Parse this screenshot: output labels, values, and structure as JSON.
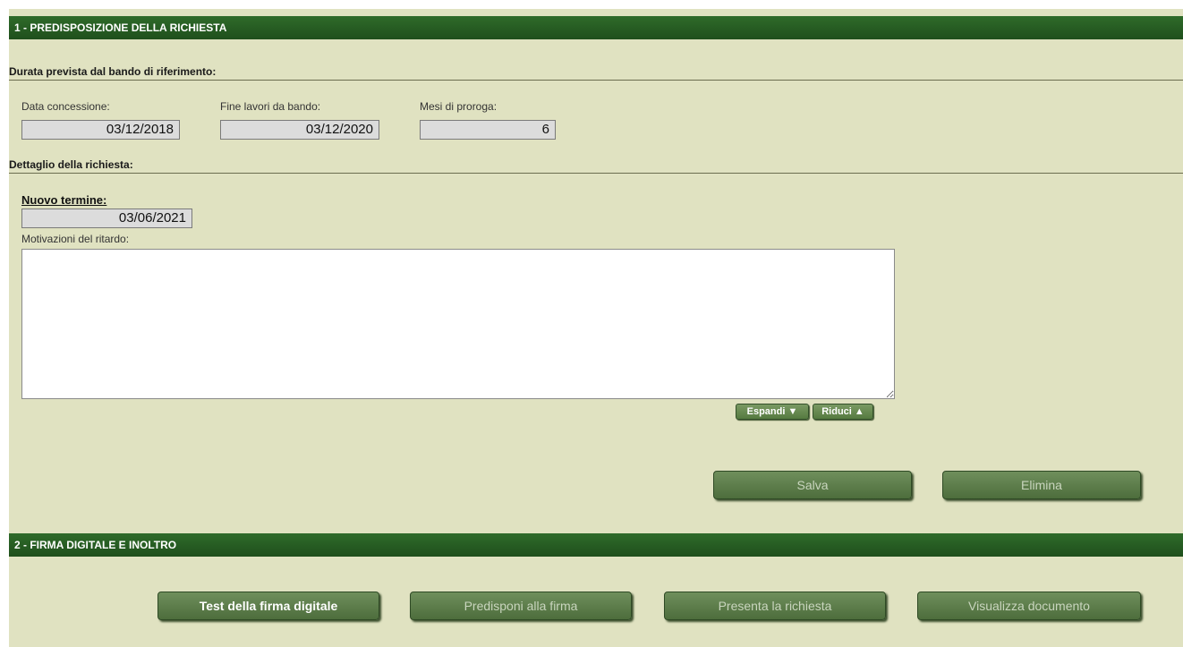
{
  "section1": {
    "title": "1 - PREDISPOSIZIONE DELLA RICHIESTA",
    "durata_subtitle": "Durata prevista dal bando di riferimento:",
    "data_concessione": {
      "label": "Data concessione:",
      "value": "03/12/2018"
    },
    "fine_lavori": {
      "label": "Fine lavori da bando:",
      "value": "03/12/2020"
    },
    "mesi_proroga": {
      "label": "Mesi di proroga:",
      "value": "6"
    },
    "dettaglio_subtitle": "Dettaglio della richiesta:",
    "nuovo_termine": {
      "label": "Nuovo termine:",
      "value": "03/06/2021"
    },
    "motivazioni": {
      "label": "Motivazioni del ritardo:",
      "value": ""
    },
    "espandi_label": "Espandi ▼",
    "riduci_label": "Riduci ▲",
    "salva_label": "Salva",
    "elimina_label": "Elimina"
  },
  "section2": {
    "title": "2 - FIRMA DIGITALE E INOLTRO",
    "test_firma_label": "Test della firma digitale",
    "predisponi_label": "Predisponi alla firma",
    "presenta_label": "Presenta la richiesta",
    "visualizza_label": "Visualizza documento"
  }
}
